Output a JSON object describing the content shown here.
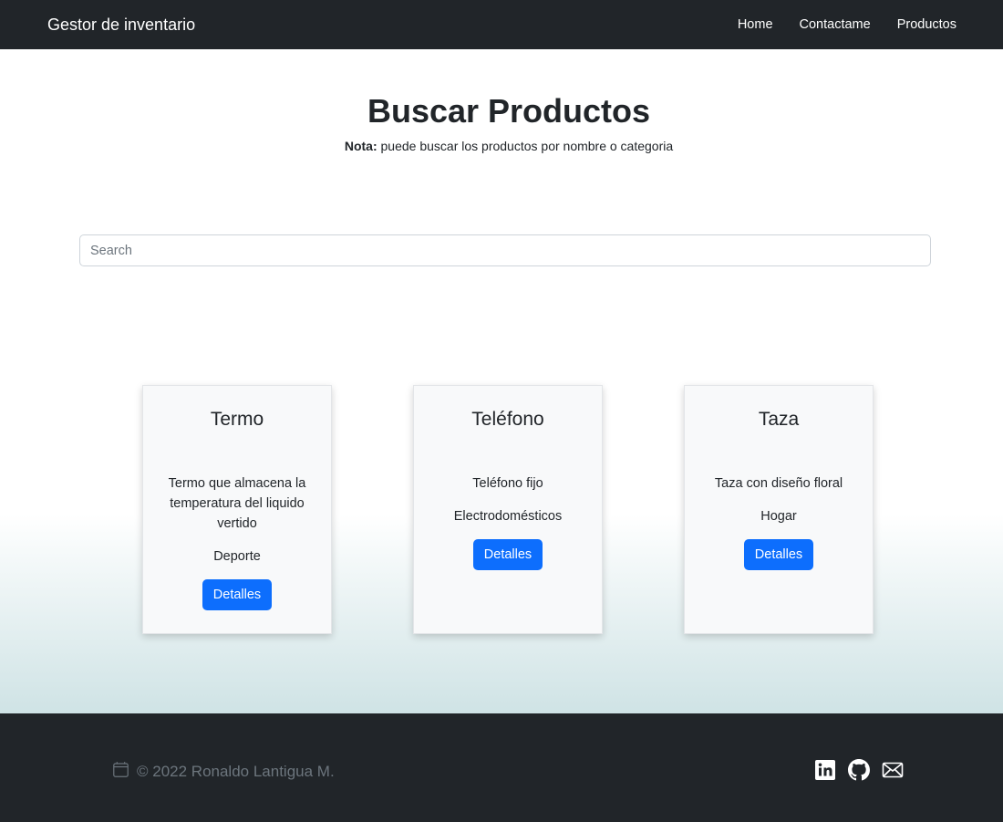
{
  "navbar": {
    "brand": "Gestor de inventario",
    "links": [
      "Home",
      "Contactame",
      "Productos"
    ]
  },
  "header": {
    "title": "Buscar Productos",
    "note_label": "Nota:",
    "note_text": " puede buscar los productos por nombre o categoria"
  },
  "search": {
    "placeholder": "Search",
    "value": ""
  },
  "products": [
    {
      "name": "Termo",
      "description": "Termo que almacena la temperatura del liquido vertido",
      "category": "Deporte",
      "button": "Detalles"
    },
    {
      "name": "Teléfono",
      "description": "Teléfono fijo",
      "category": "Electrodomésticos",
      "button": "Detalles"
    },
    {
      "name": "Taza",
      "description": "Taza con diseño floral",
      "category": "Hogar",
      "button": "Detalles"
    }
  ],
  "footer": {
    "copyright": "© 2022 Ronaldo Lantigua M.",
    "icons": [
      "calendar-icon",
      "linkedin-icon",
      "github-icon",
      "envelope-icon"
    ]
  },
  "colors": {
    "navbar_bg": "#212529",
    "primary": "#0d6efd",
    "card_bg": "#f8f9fa",
    "footer_text": "#6c757d"
  }
}
